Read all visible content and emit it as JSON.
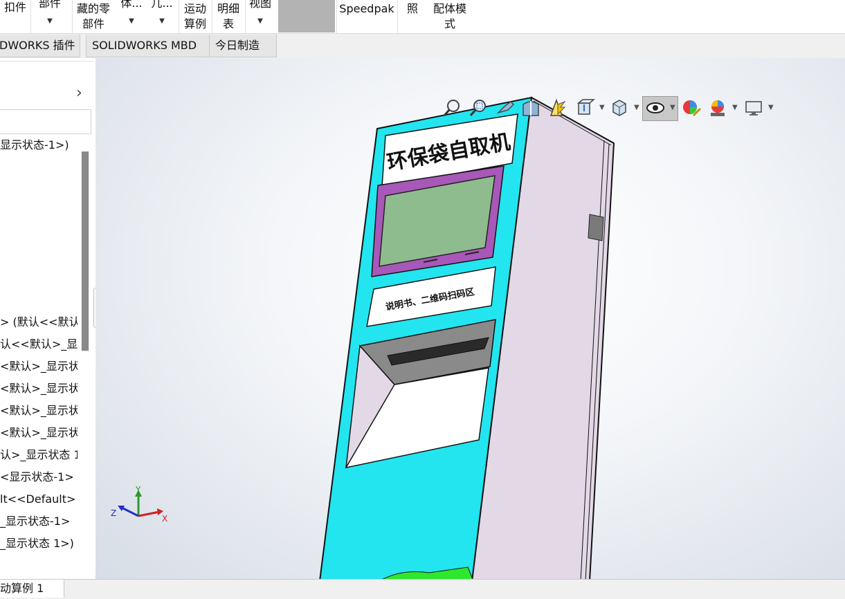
{
  "ribbon": {
    "items": [
      {
        "label": "扣件",
        "has_arrow": false
      },
      {
        "label": "部件",
        "has_arrow": true
      },
      {
        "label": "藏的零",
        "label2": "部件"
      },
      {
        "label": "体...",
        "has_arrow": true
      },
      {
        "label": "几...",
        "has_arrow": true
      },
      {
        "label": "运动",
        "label2": "算例"
      },
      {
        "label": "明细",
        "label2": "表"
      },
      {
        "label": "视图",
        "has_arrow": true
      },
      {
        "label": "Speedpak"
      },
      {
        "label": "照"
      },
      {
        "label": "配体模",
        "label2": "式"
      }
    ]
  },
  "tabs": [
    "DWORKS 插件",
    "SOLIDWORKS MBD",
    "今日制造"
  ],
  "view_toolbar": {
    "icons": [
      "zoom-to-fit-icon",
      "zoom-to-area-icon",
      "previous-view-icon",
      "section-view-icon",
      "dynamic-annotation-icon",
      "view-orientation-icon",
      "display-style-icon",
      "hide-show-items-icon",
      "edit-appearance-icon",
      "apply-scene-icon",
      "view-settings-icon"
    ],
    "active": "hide-show-items-icon"
  },
  "tree": {
    "items": [
      "显示状态-1>)",
      "> (默认<<默认",
      "认<<默认>_显",
      "<默认>_显示状",
      "<默认>_显示状",
      "<默认>_显示状",
      "<默认>_显示状",
      "认>_显示状态 1",
      "<显示状态-1>",
      "lt<<Default>",
      "_显示状态-1>",
      "_显示状态 1>)"
    ]
  },
  "model": {
    "title": "环保袋自取机",
    "scan_label": "说明书、二维码扫码区",
    "colors": {
      "body": "#22e5f0",
      "side": "#e2d8e6",
      "screen_frame": "#a858b8",
      "screen": "#8fbc8f"
    }
  },
  "triad": {
    "x": "X",
    "y": "Y",
    "z": "Z"
  },
  "status": {
    "tab": "动算例 1"
  }
}
